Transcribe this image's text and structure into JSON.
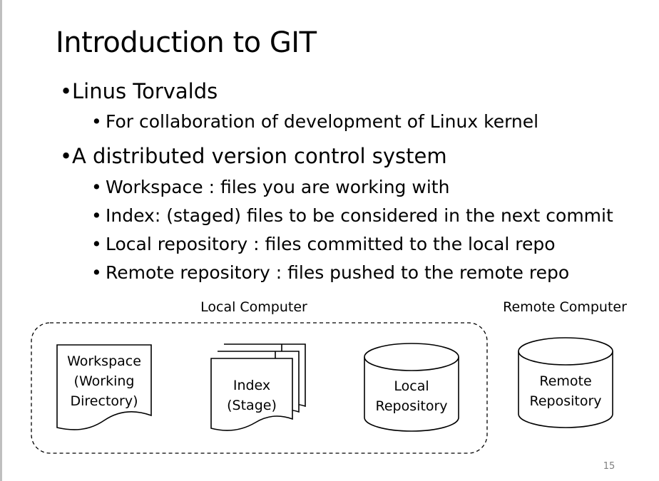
{
  "title": "Introduction to GIT",
  "bullets": [
    {
      "text": "Linus Torvalds",
      "children": [
        "For collaboration of development of Linux kernel"
      ]
    },
    {
      "text": "A distributed version control system",
      "children": [
        "Workspace : files you are working with",
        "Index: (staged) files to be considered in the next commit",
        "Local repository : files committed to the local repo",
        "Remote repository : files pushed to the remote repo"
      ]
    }
  ],
  "diagram": {
    "local_group_label": "Local Computer",
    "remote_group_label": "Remote Computer",
    "workspace_label": "Workspace\n(Working\nDirectory)",
    "index_label": "Index\n(Stage)",
    "local_repo_label": "Local\nRepository",
    "remote_repo_label": "Remote\nRepository"
  },
  "page_number": "15",
  "colors": {
    "border": "#bfbfbf",
    "page_number": "#7f7f7f",
    "stroke": "#000000"
  }
}
